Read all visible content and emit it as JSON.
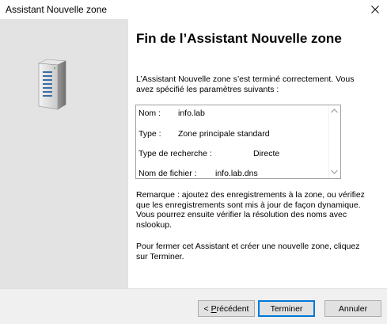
{
  "window": {
    "title": "Assistant Nouvelle zone"
  },
  "content": {
    "heading": "Fin de l’Assistant Nouvelle zone",
    "intro_line1": "L’Assistant Nouvelle zone s’est terminé correctement. Vous",
    "intro_line2": "avez spécifié les paramètres suivants :",
    "summary": [
      {
        "key": "Nom :",
        "value": "info.lab"
      },
      {
        "key": "Type :",
        "value": "Zone principale standard"
      },
      {
        "key": "Type de recherche :",
        "value": "Directe"
      },
      {
        "key": "Nom de fichier :",
        "value": "info.lab.dns"
      }
    ],
    "remark_lines": [
      "Remarque : ajoutez des enregistrements à la zone, ou vérifiez",
      "que les enregistrements sont mis à jour de façon dynamique.",
      "Vous pourrez ensuite vérifier la résolution des noms avec",
      "nslookup."
    ],
    "finish_lines": [
      "Pour fermer cet Assistant et créer une nouvelle zone, cliquez",
      "sur Terminer."
    ]
  },
  "buttons": {
    "back_prefix": "< ",
    "back_mnemonic": "P",
    "back_rest": "récédent",
    "finish": "Terminer",
    "cancel": "Annuler"
  },
  "icons": {
    "close": "close-icon",
    "server": "server-icon",
    "scroll_up": "chevron-up-icon",
    "scroll_down": "chevron-down-icon"
  }
}
